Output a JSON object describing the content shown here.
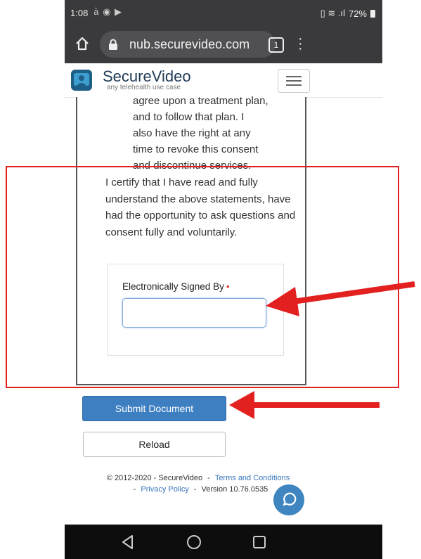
{
  "status_bar": {
    "time": "1:08",
    "battery": "72%"
  },
  "browser": {
    "url": "nub.securevideo.com",
    "tab_count": "1"
  },
  "site": {
    "brand": "SecureVideo",
    "tagline": "any telehealth use case"
  },
  "document": {
    "consent_lines": [
      "agree upon a treatment plan,",
      "and to follow that plan.  I",
      "also have the right at any",
      "time to revoke this consent",
      "and discontinue services."
    ],
    "certify_text": "I certify that I have read and fully understand the above statements, have had the opportunity to ask questions and consent fully and voluntarily.",
    "signature_label": "Electronically Signed By",
    "required_marker": "•",
    "signature_value": ""
  },
  "buttons": {
    "submit": "Submit Document",
    "reload": "Reload"
  },
  "footer": {
    "copyright": "© 2012-2020 - SecureVideo",
    "separator": "-",
    "terms": "Terms and Conditions",
    "privacy": "Privacy Policy",
    "version": "Version 10.76.0535"
  },
  "colors": {
    "primary": "#3d7fc1",
    "brand_dark": "#1f3b56",
    "annotation": "#e32020",
    "browser_bar": "#3a3a3c"
  },
  "icons": [
    "home-icon",
    "lock-icon",
    "tabs-icon",
    "more-vert-icon",
    "securevideo-logo",
    "menu-icon",
    "chat-icon",
    "back-icon",
    "home-circle-icon",
    "recents-icon"
  ]
}
